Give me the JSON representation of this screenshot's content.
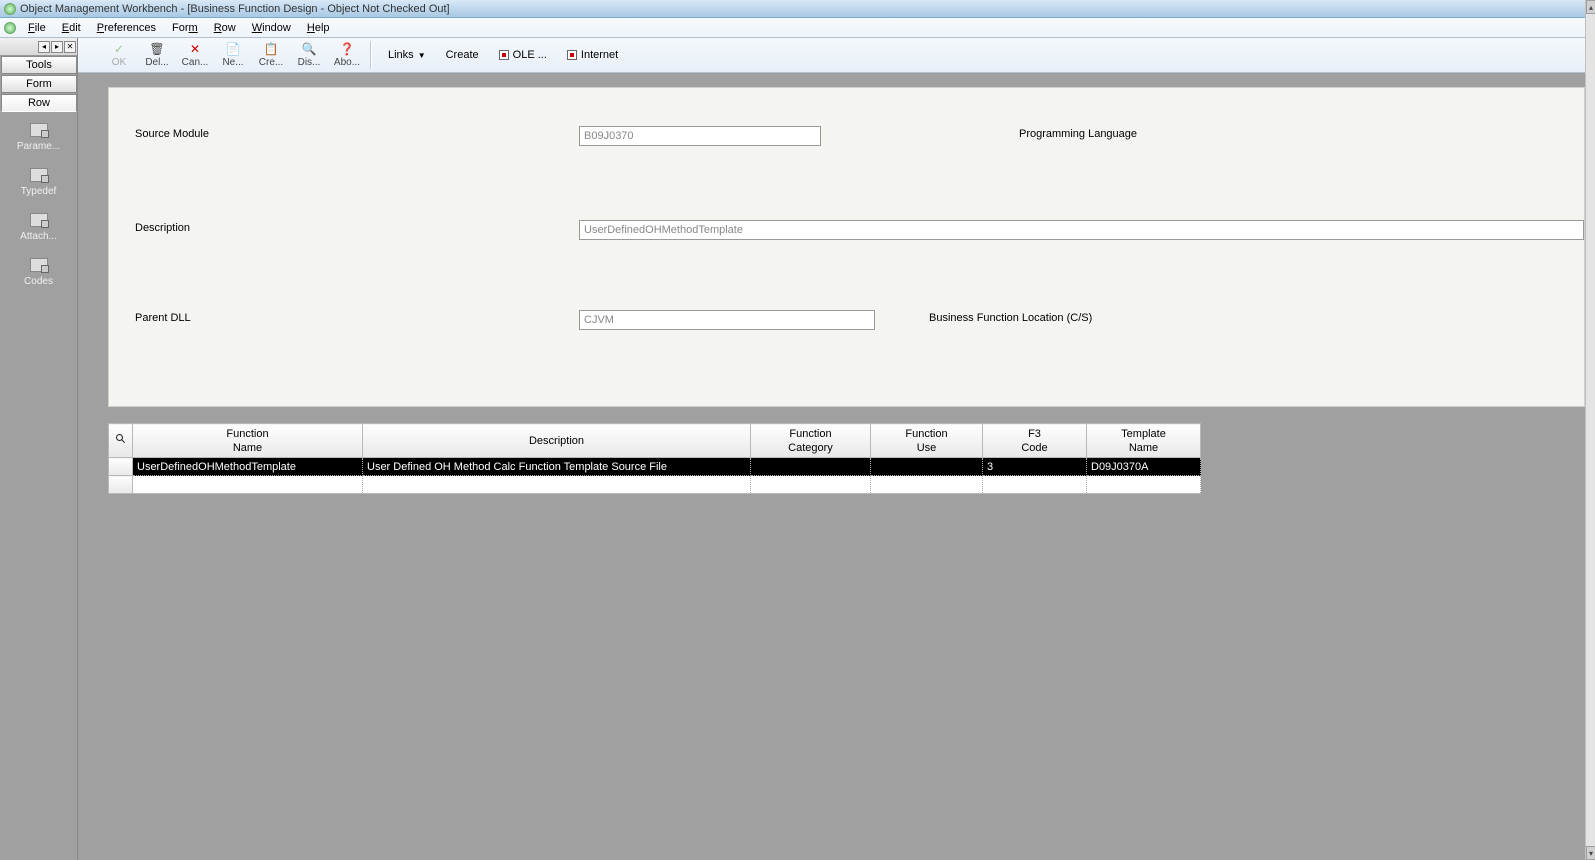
{
  "title": "Object Management Workbench - [Business Function Design - Object Not Checked Out]",
  "menubar": {
    "file": "File",
    "edit": "Edit",
    "preferences": "Preferences",
    "form": "Form",
    "row": "Row",
    "window": "Window",
    "help": "Help"
  },
  "toolbar": {
    "ok": "OK",
    "del": "Del...",
    "can": "Can...",
    "new": "Ne...",
    "cre": "Cre...",
    "dis": "Dis...",
    "abo": "Abo...",
    "links": "Links",
    "create": "Create",
    "ole": "OLE ...",
    "internet": "Internet"
  },
  "sidebar_tabs": {
    "tools": "Tools",
    "form": "Form",
    "row": "Row"
  },
  "sidebar_actions": {
    "parame": "Parame...",
    "typedef": "Typedef",
    "attach": "Attach...",
    "codes": "Codes"
  },
  "form": {
    "source_module_label": "Source Module",
    "source_module_value": "B09J0370",
    "programming_language_label": "Programming Language",
    "description_label": "Description",
    "description_value": "UserDefinedOHMethodTemplate",
    "parent_dll_label": "Parent DLL",
    "parent_dll_value": "CJVM",
    "bf_location_label": "Business Function Location (C/S)"
  },
  "grid": {
    "headers": {
      "function_name": "Function\nName",
      "description": "Description",
      "function_category": "Function\nCategory",
      "function_use": "Function\nUse",
      "f3_code": "F3\nCode",
      "template_name": "Template\nName"
    },
    "rows": [
      {
        "function_name": "UserDefinedOHMethodTemplate",
        "description": "User Defined OH Method Calc Function Template Source File",
        "function_category": "",
        "function_use": "",
        "f3_code": "3",
        "template_name": "D09J0370A"
      }
    ]
  }
}
